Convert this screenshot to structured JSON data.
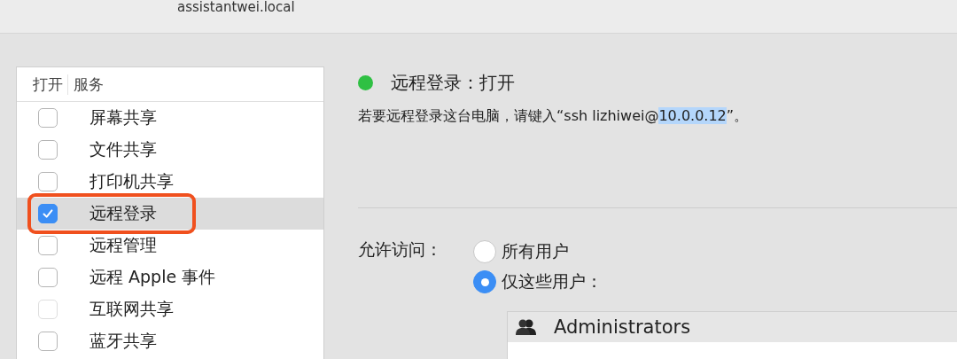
{
  "window": {
    "title": "assistantwei.local"
  },
  "services": {
    "columns": [
      "打开",
      "服务"
    ],
    "rows": [
      {
        "name": "屏幕共享",
        "checked": false,
        "disabled": false,
        "selected": false
      },
      {
        "name": "文件共享",
        "checked": false,
        "disabled": false,
        "selected": false
      },
      {
        "name": "打印机共享",
        "checked": false,
        "disabled": false,
        "selected": false
      },
      {
        "name": "远程登录",
        "checked": true,
        "disabled": false,
        "selected": true
      },
      {
        "name": "远程管理",
        "checked": false,
        "disabled": false,
        "selected": false
      },
      {
        "name": "远程 Apple 事件",
        "checked": false,
        "disabled": false,
        "selected": false
      },
      {
        "name": "互联网共享",
        "checked": false,
        "disabled": true,
        "selected": false
      },
      {
        "name": "蓝牙共享",
        "checked": false,
        "disabled": false,
        "selected": false
      }
    ]
  },
  "detail": {
    "status": {
      "label": "远程登录：打开",
      "on": true
    },
    "instruction": [
      {
        "text": "若要远程登录这台电脑，请键入“ssh lizhiwei@",
        "selected": false
      },
      {
        "text": "10.0.0.12",
        "selected": true
      },
      {
        "text": "”。",
        "selected": false
      }
    ],
    "access_label": "允许访问：",
    "access_options": [
      {
        "label": "所有用户",
        "selected": false
      },
      {
        "label": "仅这些用户：",
        "selected": true
      }
    ],
    "users": [
      {
        "name": "Administrators",
        "kind": "group"
      }
    ]
  }
}
